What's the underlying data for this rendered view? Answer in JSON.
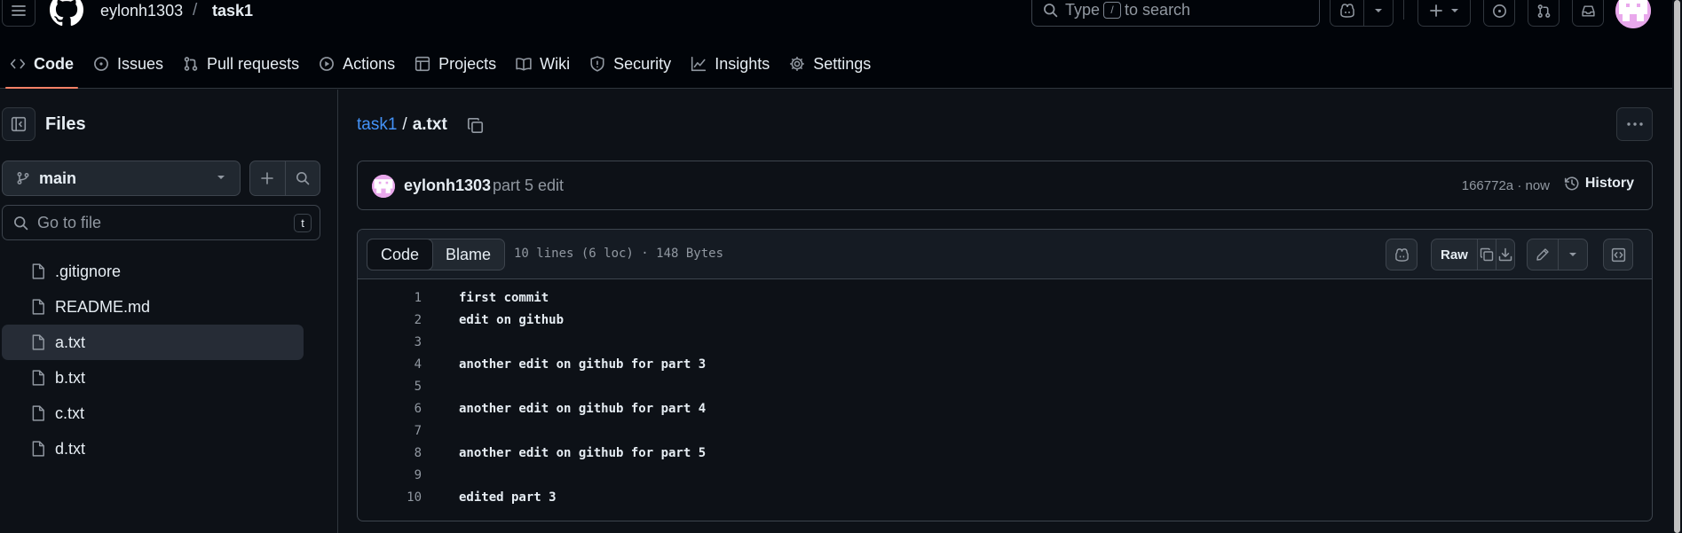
{
  "header": {
    "owner": "eylonh1303",
    "separator": "/",
    "repo": "task1",
    "search": {
      "prefix": "Type",
      "key": "/",
      "suffix": "to search"
    }
  },
  "repo_nav": [
    {
      "label": "Code",
      "icon": "code-icon",
      "active": true
    },
    {
      "label": "Issues",
      "icon": "issue-icon"
    },
    {
      "label": "Pull requests",
      "icon": "pull-request-icon"
    },
    {
      "label": "Actions",
      "icon": "play-icon"
    },
    {
      "label": "Projects",
      "icon": "table-icon"
    },
    {
      "label": "Wiki",
      "icon": "book-icon"
    },
    {
      "label": "Security",
      "icon": "shield-icon"
    },
    {
      "label": "Insights",
      "icon": "graph-icon"
    },
    {
      "label": "Settings",
      "icon": "gear-icon"
    }
  ],
  "sidebar": {
    "title": "Files",
    "branch": "main",
    "goto_placeholder": "Go to file",
    "goto_key": "t",
    "files": [
      {
        "name": ".gitignore",
        "selected": false
      },
      {
        "name": "README.md",
        "selected": false
      },
      {
        "name": "a.txt",
        "selected": true
      },
      {
        "name": "b.txt",
        "selected": false
      },
      {
        "name": "c.txt",
        "selected": false
      },
      {
        "name": "d.txt",
        "selected": false
      }
    ]
  },
  "breadcrumb": {
    "repo": "task1",
    "separator": "/",
    "file": "a.txt"
  },
  "commit": {
    "author": "eylonh1303",
    "message": "part 5 edit",
    "meta": "166772a · now",
    "history_label": "History"
  },
  "file_view": {
    "tabs": [
      "Code",
      "Blame"
    ],
    "info": "10 lines (6 loc) · 148 Bytes",
    "raw_label": "Raw",
    "lines": [
      {
        "n": "1",
        "text": "first commit"
      },
      {
        "n": "2",
        "text": "edit on github"
      },
      {
        "n": "3",
        "text": ""
      },
      {
        "n": "4",
        "text": "another edit on github for part 3"
      },
      {
        "n": "5",
        "text": ""
      },
      {
        "n": "6",
        "text": "another edit on github for part 4"
      },
      {
        "n": "7",
        "text": ""
      },
      {
        "n": "8",
        "text": "another edit on github for part 5"
      },
      {
        "n": "9",
        "text": ""
      },
      {
        "n": "10",
        "text": "edited part 3"
      }
    ]
  },
  "colors": {
    "background": "#0d1117",
    "header_bg": "#010409",
    "link": "#4493f8",
    "active_tab_underline": "#f78166",
    "border": "#30363d",
    "muted_text": "#9198a1"
  }
}
